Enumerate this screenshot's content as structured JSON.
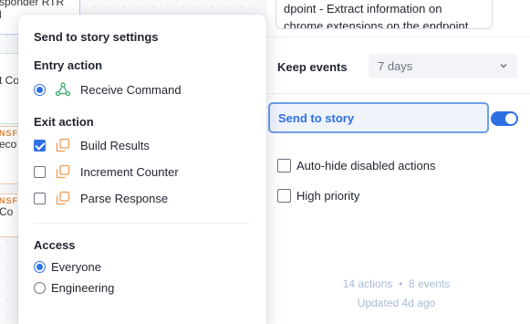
{
  "canvas": {
    "nodes": [
      {
        "tag": "",
        "text": "sponder RTR",
        "text2": "l"
      },
      {
        "tag": "",
        "text": "t Co",
        "text2": ""
      },
      {
        "tag": "NSF",
        "text": "eco",
        "text2": ""
      },
      {
        "tag": "NSF",
        "text": "Co",
        "text2": ""
      }
    ]
  },
  "popover": {
    "title": "Send to story settings",
    "entry": {
      "label": "Entry action",
      "options": [
        {
          "label": "Receive Command",
          "selected": true,
          "icon": "webhook-icon"
        }
      ]
    },
    "exit": {
      "label": "Exit action",
      "options": [
        {
          "label": "Build Results",
          "checked": true,
          "icon": "event-transform-icon"
        },
        {
          "label": "Increment Counter",
          "checked": false,
          "icon": "event-transform-icon"
        },
        {
          "label": "Parse Response",
          "checked": false,
          "icon": "event-transform-icon"
        }
      ]
    },
    "access": {
      "label": "Access",
      "options": [
        {
          "label": "Everyone",
          "selected": true
        },
        {
          "label": "Engineering",
          "selected": false
        }
      ]
    }
  },
  "right": {
    "description": "dpoint - Extract information on chrome extensions on the endpoint",
    "keep_events": {
      "label": "Keep events",
      "value": "7 days"
    },
    "send_to_story": {
      "label": "Send to story",
      "enabled": true
    },
    "options": [
      {
        "label": "Auto-hide disabled actions",
        "checked": false
      },
      {
        "label": "High priority",
        "checked": false
      }
    ],
    "stats": {
      "actions": "14 actions",
      "separator": "•",
      "events": "8 events",
      "updated": "Updated 4d ago"
    }
  },
  "colors": {
    "accent": "#2f6fe4",
    "webhook_icon": "#4bb07a",
    "transform_icon": "#ef9a52"
  }
}
